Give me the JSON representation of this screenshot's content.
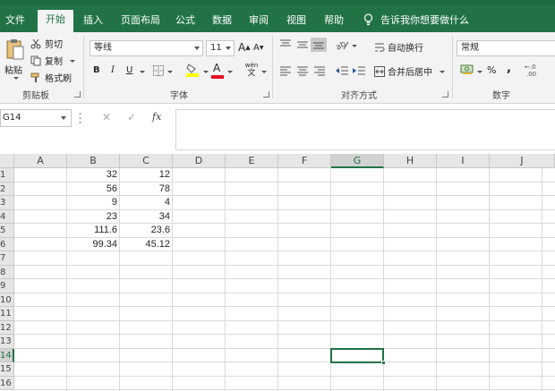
{
  "tabs": [
    {
      "label": "文件",
      "active": false
    },
    {
      "label": "开始",
      "active": true
    },
    {
      "label": "插入",
      "active": false
    },
    {
      "label": "页面布局",
      "active": false
    },
    {
      "label": "公式",
      "active": false
    },
    {
      "label": "数据",
      "active": false
    },
    {
      "label": "审阅",
      "active": false
    },
    {
      "label": "视图",
      "active": false
    },
    {
      "label": "帮助",
      "active": false
    }
  ],
  "tell_me": "告诉我你想要做什么",
  "ribbon": {
    "clipboard": {
      "paste": "粘贴",
      "cut": "剪切",
      "copy": "复制",
      "format_painter": "格式刷",
      "group_label": "剪贴板"
    },
    "font": {
      "font_name": "等线",
      "font_size": "11",
      "grow_font": "A",
      "shrink_font": "A",
      "bold": "B",
      "italic": "I",
      "underline": "U",
      "font_color_glyph": "A",
      "phonetic_top": "wén",
      "phonetic_bottom": "文",
      "group_label": "字体"
    },
    "alignment": {
      "wrap_text": "自动换行",
      "merge_center": "合并后居中",
      "group_label": "对齐方式"
    },
    "number": {
      "format": "常规",
      "percent": "%",
      "comma": ",",
      "inc_decimal": "+.0\n.00",
      "group_label": "数字"
    }
  },
  "formula_bar": {
    "name_box": "G14",
    "cancel": "✕",
    "enter": "✓",
    "fx": "fx",
    "content": ""
  },
  "columns": [
    "A",
    "B",
    "C",
    "D",
    "E",
    "F",
    "G",
    "H",
    "I",
    "J"
  ],
  "rows": [
    "1",
    "2",
    "3",
    "4",
    "5",
    "6",
    "7",
    "8",
    "9",
    "10",
    "11",
    "12",
    "13",
    "14",
    "15",
    "16"
  ],
  "selected": {
    "column": "G",
    "row": "14"
  },
  "cells": {
    "B": [
      "32",
      "56",
      "9",
      "23",
      "111.6",
      "99.34"
    ],
    "C": [
      "12",
      "78",
      "4",
      "34",
      "23.6",
      "45.12"
    ]
  },
  "colors": {
    "accent": "#217346",
    "ribbon_bg": "#f3f3f3",
    "header_bg": "#e6e6e6",
    "font_color_bar": "#e81123",
    "fill_color_bar": "#ffff00"
  }
}
